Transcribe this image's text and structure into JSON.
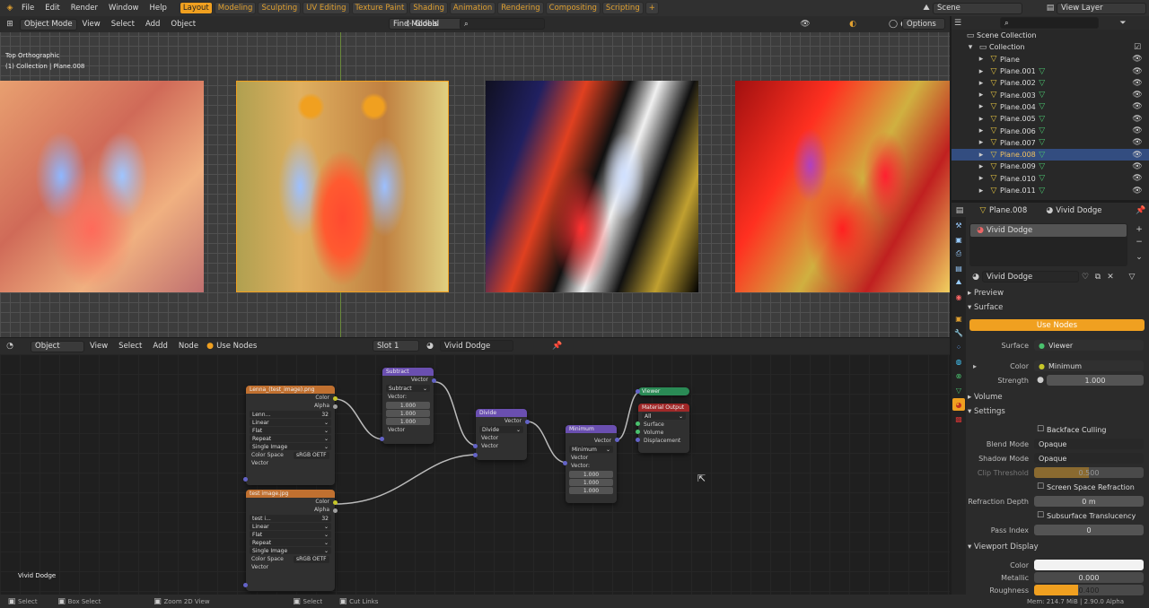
{
  "menu": [
    "File",
    "Edit",
    "Render",
    "Window",
    "Help"
  ],
  "workspaces": [
    "Layout",
    "Modeling",
    "Sculpting",
    "UV Editing",
    "Texture Paint",
    "Shading",
    "Animation",
    "Rendering",
    "Compositing",
    "Scripting",
    "+"
  ],
  "scene": {
    "label": "Scene",
    "view_layer": "View Layer"
  },
  "viewport": {
    "mode": "Object Mode",
    "menus": [
      "View",
      "Select",
      "Add",
      "Object"
    ],
    "transform": "Global",
    "find": "Find Models",
    "options": "Options",
    "overlay_title": "Top Orthographic",
    "overlay_sub": "(1) Collection | Plane.008"
  },
  "node_editor": {
    "type": "Object",
    "menus": [
      "View",
      "Select",
      "Add",
      "Node"
    ],
    "use_nodes": "Use Nodes",
    "slot": "Slot 1",
    "material": "Vivid Dodge",
    "footer_label": "Vivid Dodge",
    "img1": {
      "title": "Lenna_(test_image).png",
      "color": "Color",
      "alpha": "Alpha",
      "name": "Lenn...",
      "num": "32",
      "interp": "Linear",
      "proj": "Flat",
      "ext": "Repeat",
      "src": "Single Image",
      "cs_label": "Color Space",
      "cs": "sRGB OETF",
      "vector": "Vector"
    },
    "img2": {
      "title": "test image.jpg",
      "color": "Color",
      "alpha": "Alpha",
      "name": "test i...",
      "num": "32",
      "interp": "Linear",
      "proj": "Flat",
      "ext": "Repeat",
      "src": "Single Image",
      "cs_label": "Color Space",
      "cs": "sRGB OETF",
      "vector": "Vector"
    },
    "subtract": {
      "title": "Subtract",
      "out": "Vector",
      "op": "Subtract",
      "vec": "Vector:",
      "v1": "1.000",
      "v2": "1.000",
      "v3": "1.000",
      "in": "Vector"
    },
    "divide": {
      "title": "Divide",
      "out": "Vector",
      "op": "Divide",
      "in1": "Vector",
      "in2": "Vector"
    },
    "minimum": {
      "title": "Minimum",
      "out": "Vector",
      "op": "Minimum",
      "in1": "Vector",
      "vec": "Vector:",
      "v1": "1.000",
      "v2": "1.000",
      "v3": "1.000"
    },
    "viewer": {
      "title": "Viewer"
    },
    "output": {
      "title": "Material Output",
      "target": "All",
      "surface": "Surface",
      "volume": "Volume",
      "displacement": "Displacement"
    }
  },
  "status": [
    "Select",
    "Box Select",
    "Zoom 2D View",
    "Select",
    "Cut Links"
  ],
  "status_right": "Mem: 214.7 MiB | 2.90.0 Alpha",
  "outliner": {
    "root": "Scene Collection",
    "collection": "Collection",
    "items": [
      "Plane",
      "Plane.001",
      "Plane.002",
      "Plane.003",
      "Plane.004",
      "Plane.005",
      "Plane.006",
      "Plane.007",
      "Plane.008",
      "Plane.009",
      "Plane.010",
      "Plane.011"
    ],
    "selected": "Plane.008"
  },
  "properties": {
    "object": "Plane.008",
    "material": "Vivid Dodge",
    "slot_name": "Vivid Dodge",
    "mat_field": "Vivid Dodge",
    "preview": "Preview",
    "surface": "Surface",
    "use_nodes": "Use Nodes",
    "surf_label": "Surface",
    "surf_val": "Viewer",
    "color_label": "Color",
    "color_val": "Minimum",
    "strength_label": "Strength",
    "strength_val": "1.000",
    "volume": "Volume",
    "settings": "Settings",
    "backface": "Backface Culling",
    "blend_label": "Blend Mode",
    "blend_val": "Opaque",
    "shadow_label": "Shadow Mode",
    "shadow_val": "Opaque",
    "clip_label": "Clip Threshold",
    "clip_val": "0.500",
    "ssr": "Screen Space Refraction",
    "refr_label": "Refraction Depth",
    "refr_val": "0 m",
    "sss": "Subsurface Translucency",
    "pass_label": "Pass Index",
    "pass_val": "0",
    "vpd": "Viewport Display",
    "vcolor_label": "Color",
    "metal_label": "Metallic",
    "metal_val": "0.000",
    "rough_label": "Roughness",
    "rough_val": "0.400"
  },
  "colors": {
    "accent": "#f0a020",
    "selected_row": "#334d80",
    "node_image": "#c07030",
    "node_math": "#6a4fb0",
    "node_output": "#a02828",
    "node_viewer": "#2a8a55"
  }
}
